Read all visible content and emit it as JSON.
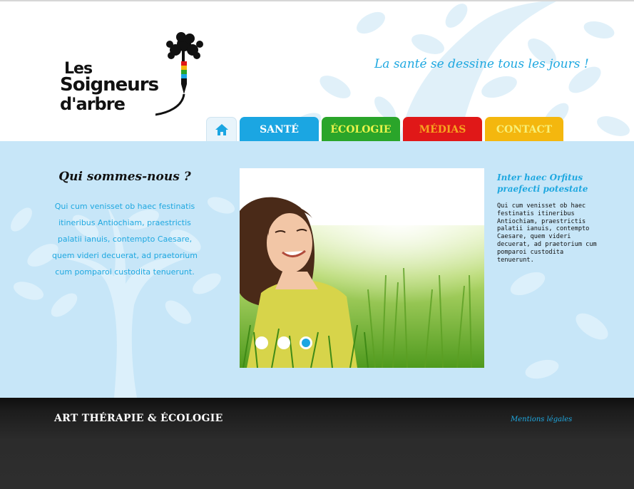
{
  "header": {
    "logo": {
      "line1": "Les",
      "line2": "Soigneurs",
      "line3": "d'arbre"
    },
    "tagline": "La santé se dessine tous les jours !"
  },
  "nav": {
    "home_icon": "home-icon",
    "tabs": [
      {
        "label": "SANTÉ",
        "color": "#1ba6e2"
      },
      {
        "label": "ÉCOLOGIE",
        "color": "#2aa52a"
      },
      {
        "label": "MÉDIAS",
        "color": "#e01818"
      },
      {
        "label": "CONTACT",
        "color": "#f4b70e"
      }
    ]
  },
  "about": {
    "title": "Qui sommes-nous ?",
    "text": "Qui cum venisset ob haec festinatis itineribus Antiochiam, praestrictis palatii ianuis, contempto Caesare, quem videri decuerat, ad praetorium cum pomparoi custodita tenuerunt."
  },
  "slider": {
    "image": "young woman lying in green grass looking up",
    "slides": 3,
    "active_slide": 3
  },
  "sidebar": {
    "title": "Inter haec Orfitus praefecti potestate",
    "text": "Qui cum venisset ob haec festinatis itineribus Antiochiam, praestrictis palatii ianuis, contempto Caesare, quem videri decuerat, ad praetorium cum pomparoi custodita tenuerunt."
  },
  "footer": {
    "brand": "ART THÉRAPIE & ÉCOLOGIE",
    "legal_link": "Mentions légales"
  },
  "colors": {
    "accent_blue": "#1fa8e0",
    "band_blue": "#c7e6f8",
    "footer_dark": "#2e2e2e"
  }
}
